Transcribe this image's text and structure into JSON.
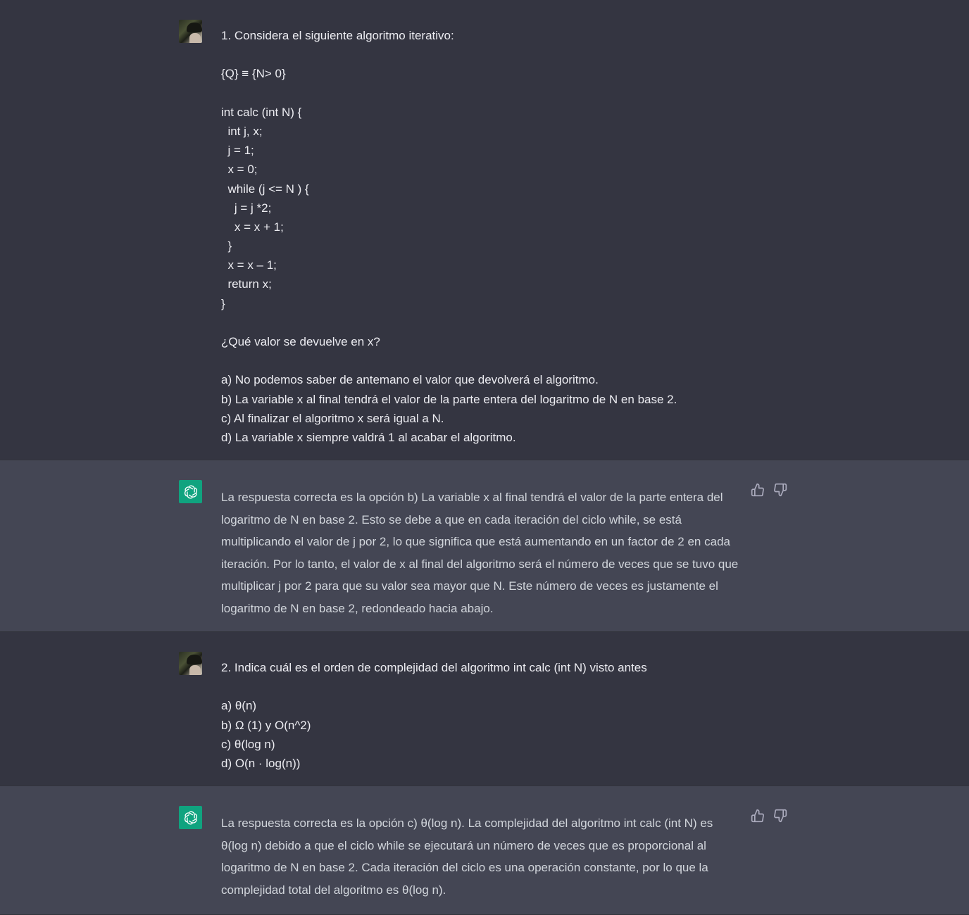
{
  "conversation": {
    "messages": [
      {
        "role": "user",
        "lines": [
          "1. Considera el siguiente algoritmo iterativo:",
          "",
          "{Q} ≡ {N> 0}",
          "",
          "int calc (int N) {",
          "  int j, x;",
          "  j = 1;",
          "  x = 0;",
          "  while (j <= N ) {",
          "    j = j *2;",
          "    x = x + 1;",
          "  }",
          "  x = x – 1;",
          "  return x;",
          "}",
          "",
          "¿Qué valor se devuelve en x?",
          "",
          "a) No podemos saber de antemano el valor que devolverá el algoritmo.",
          "b) La variable x al final tendrá el valor de la parte entera del logaritmo de N en base 2.",
          "c) Al finalizar el algoritmo x será igual a N.",
          "d) La variable x siempre valdrá 1 al acabar el algoritmo."
        ]
      },
      {
        "role": "assistant",
        "text": "La respuesta correcta es la opción b) La variable x al final tendrá el valor de la parte entera del logaritmo de N en base 2. Esto se debe a que en cada iteración del ciclo while, se está multiplicando el valor de j por 2, lo que significa que está aumentando en un factor de 2 en cada iteración. Por lo tanto, el valor de x al final del algoritmo será el número de veces que se tuvo que multiplicar j por 2 para que su valor sea mayor que N. Este número de veces es justamente el logaritmo de N en base 2, redondeado hacia abajo."
      },
      {
        "role": "user",
        "lines": [
          "2. Indica cuál es el orden de complejidad del algoritmo int calc (int N) visto antes",
          "",
          "a) θ(n)",
          "b) Ω (1) y O(n^2)",
          "c) θ(log n)",
          "d) O(n · log(n))"
        ]
      },
      {
        "role": "assistant",
        "text": "La respuesta correcta es la opción c) θ(log n). La complejidad del algoritmo int calc (int N) es θ(log n) debido a que el ciclo while se ejecutará un número de veces que es proporcional al logaritmo de N en base 2. Cada iteración del ciclo es una operación constante, por lo que la complejidad total del algoritmo es θ(log n)."
      }
    ]
  },
  "icons": {
    "user_avatar": "user-avatar",
    "assistant_avatar": "openai-logo-icon",
    "thumbs_up": "thumbs-up-icon",
    "thumbs_down": "thumbs-down-icon"
  },
  "colors": {
    "user_bg": "#343541",
    "assistant_bg": "#444654",
    "assistant_avatar_bg": "#10a37f",
    "user_text": "#ececf1",
    "assistant_text": "#d1d5db",
    "icon_color": "#acacbe"
  }
}
